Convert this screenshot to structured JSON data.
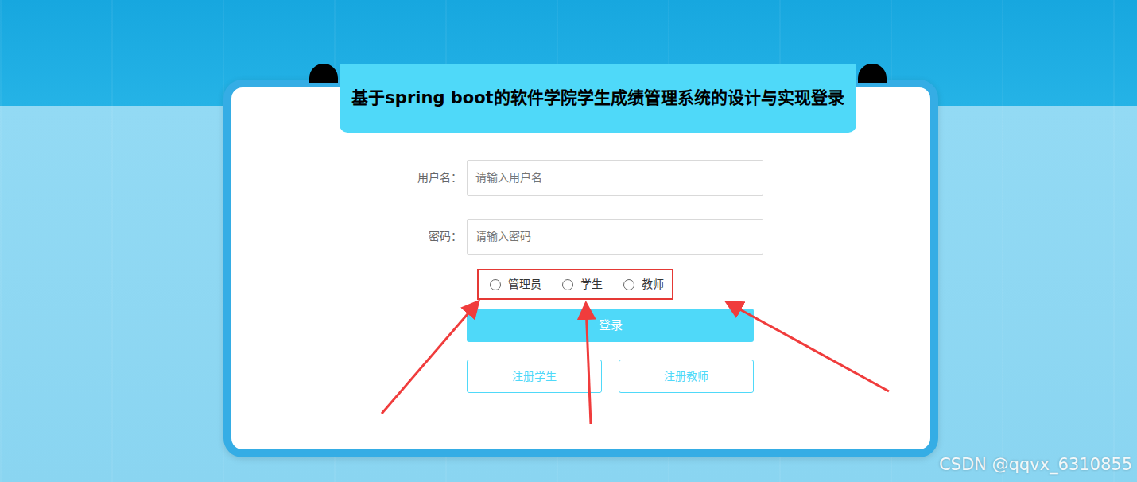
{
  "title": "基于spring boot的软件学院学生成绩管理系统的设计与实现登录",
  "form": {
    "fields": [
      {
        "label": "用户名：",
        "placeholder": "请输入用户名"
      },
      {
        "label": "密码：",
        "placeholder": "请输入密码"
      }
    ],
    "roles": [
      {
        "label": "管理员",
        "selected": false
      },
      {
        "label": "学生",
        "selected": false
      },
      {
        "label": "教师",
        "selected": false
      }
    ],
    "login_button": "登录",
    "register_buttons": [
      "注册学生",
      "注册教师"
    ]
  },
  "watermark": "CSDN @qqvx_6310855"
}
